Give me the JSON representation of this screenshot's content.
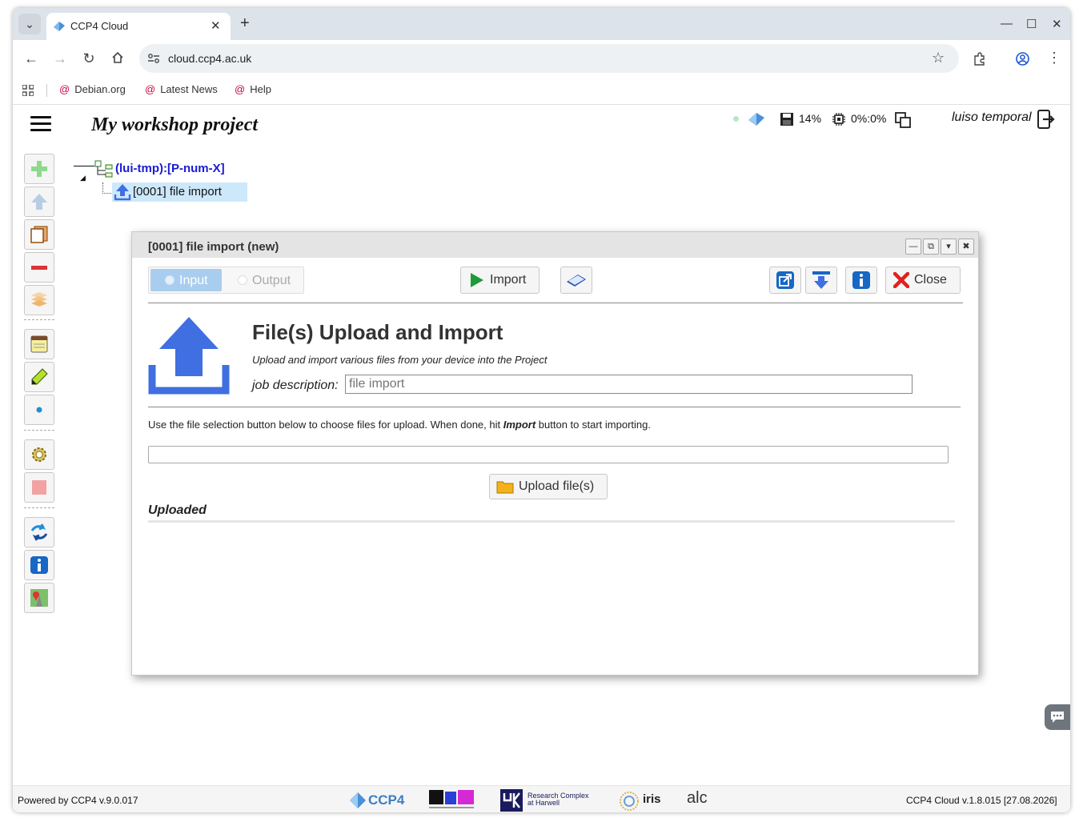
{
  "browser": {
    "tab_title": "CCP4 Cloud",
    "new_tab": "+",
    "tab_close": "✕",
    "url": "cloud.ccp4.ac.uk",
    "bookmarks": [
      {
        "label": "Debian.org"
      },
      {
        "label": "Latest News"
      },
      {
        "label": "Help"
      }
    ],
    "window_controls": {
      "minimize": "—",
      "maximize": "☐",
      "close": "✕"
    }
  },
  "app": {
    "project_title": "My workshop project",
    "disk_usage": "14%",
    "cpu_usage": "0%:0%",
    "user_name": "luiso temporal",
    "tree": {
      "root_label": "(lui-tmp):[P-num-X]",
      "child_label": "[0001] file import"
    }
  },
  "dialog": {
    "title": "[0001] file import (new)",
    "tab_input": "Input",
    "tab_output": "Output",
    "import_label": "Import",
    "close_label": "Close",
    "heading": "File(s) Upload and Import",
    "subtitle": "Upload and import various files from your device into the Project",
    "job_description_label": "job description:",
    "job_description_placeholder": "file import",
    "instructions_before": "Use the file selection button below to choose files for upload. When done, hit ",
    "instructions_emphasis": "Import",
    "instructions_after": " button to start importing.",
    "upload_button_label": "Upload file(s)",
    "uploaded_label": "Uploaded"
  },
  "footer": {
    "left": "Powered by CCP4 v.9.0.017",
    "right": "CCP4 Cloud v.1.8.015 [27.08.2026]",
    "logo_ccp4": "CCP4",
    "logo_rc": "Research Complex at Harwell",
    "logo_iris": "iris",
    "logo_alc": "alc"
  },
  "colors": {
    "accent_blue": "#3f6fe0",
    "tree_blue": "#1a1ad6",
    "selection": "#cde8fb",
    "seg_active": "#a9cdee"
  }
}
